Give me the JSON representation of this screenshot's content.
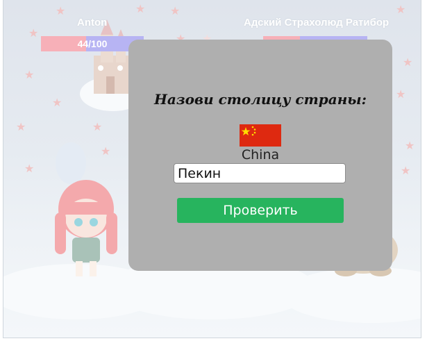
{
  "players": {
    "left": {
      "name": "Anton",
      "hp_text": "44/100",
      "hp_fraction": 0.44
    },
    "right": {
      "name": "Адский Страхолюд Ратибор",
      "hp_fraction": 0.35
    }
  },
  "question": {
    "title": "Назови столицу страны:",
    "flag_icon": "china-flag-icon",
    "country": "China",
    "answer_value": "Пекин",
    "submit_label": "Проверить"
  },
  "colors": {
    "modal_bg": "#afafaf",
    "button": "#27b45e",
    "hp_fill": "#f7b0b8",
    "hp_track": "#b7b4f3"
  }
}
